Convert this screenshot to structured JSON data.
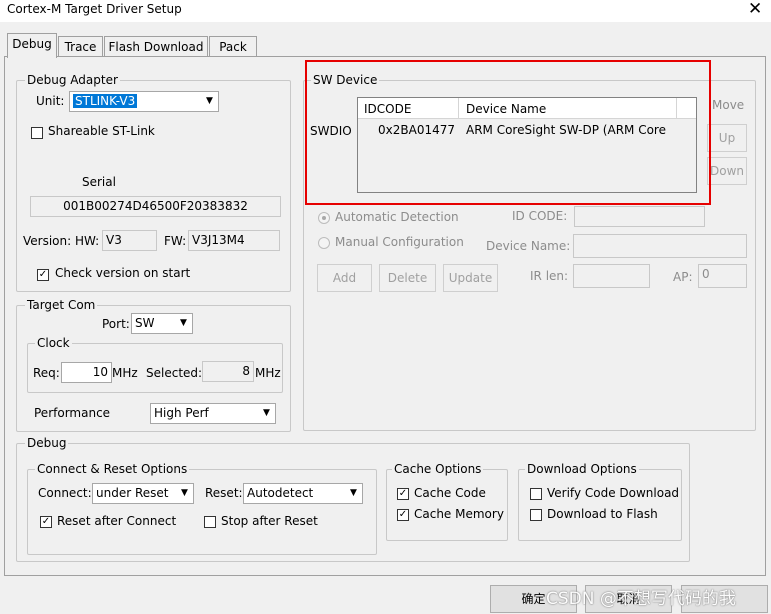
{
  "window": {
    "title": "Cortex-M Target Driver Setup",
    "close_glyph": "✕"
  },
  "tabs": [
    {
      "label": "Debug"
    },
    {
      "label": "Trace"
    },
    {
      "label": "Flash Download"
    },
    {
      "label": "Pack"
    }
  ],
  "debug_adapter": {
    "legend": "Debug Adapter",
    "unit_label": "Unit:",
    "unit_value": "STLINK-V3",
    "shareable_label": "Shareable ST-Link",
    "serial_label": "Serial",
    "serial_value": "001B00274D46500F20383832",
    "version_hw_label": "Version: HW:",
    "version_hw_value": "V3",
    "version_fw_label": "FW:",
    "version_fw_value": "V3J13M4",
    "check_version_label": "Check version on start"
  },
  "target_com": {
    "legend": "Target Com",
    "port_label": "Port:",
    "port_value": "SW",
    "clock_legend": "Clock",
    "req_label": "Req:",
    "req_value": "10",
    "req_unit": "MHz",
    "selected_label": "Selected:",
    "selected_value": "8",
    "selected_unit": "MHz",
    "performance_label": "Performance",
    "performance_value": "High Perf"
  },
  "sw_device": {
    "legend": "SW Device",
    "row_label": "SWDIO",
    "columns": [
      "IDCODE",
      "Device Name"
    ],
    "rows": [
      {
        "idcode": "0x2BA01477",
        "name": "ARM CoreSight SW-DP (ARM Core"
      }
    ],
    "move_label": "Move",
    "up_label": "Up",
    "down_label": "Down",
    "auto_detect_label": "Automatic Detection",
    "manual_config_label": "Manual Configuration",
    "id_code_label": "ID CODE:",
    "device_name_label": "Device Name:",
    "ir_len_label": "IR len:",
    "ap_label": "AP:",
    "ap_value": "0",
    "add_label": "Add",
    "delete_label": "Delete",
    "update_label": "Update"
  },
  "debug_group": {
    "legend": "Debug",
    "connect_reset_legend": "Connect & Reset Options",
    "connect_label": "Connect:",
    "connect_value": "under Reset",
    "reset_label": "Reset:",
    "reset_value": "Autodetect",
    "reset_after_connect_label": "Reset after Connect",
    "stop_after_reset_label": "Stop after Reset",
    "cache_legend": "Cache Options",
    "cache_code_label": "Cache Code",
    "cache_memory_label": "Cache Memory",
    "download_legend": "Download Options",
    "verify_code_label": "Verify Code Download",
    "download_flash_label": "Download to Flash"
  },
  "footer": {
    "ok_label": "确定",
    "cancel_label": "取消"
  },
  "watermark": "CSDN @不想写代码的我",
  "colors": {
    "highlight_box": "#e60000",
    "selection": "#0078d7"
  }
}
